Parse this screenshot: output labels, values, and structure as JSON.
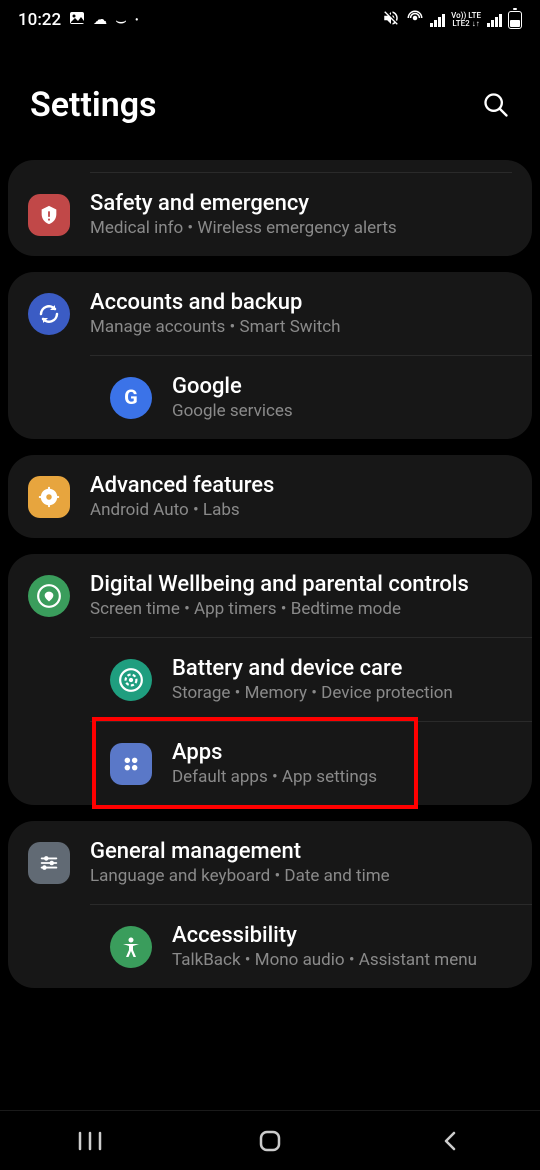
{
  "status": {
    "time": "10:22",
    "lte1": "Vo))",
    "lte2": "LTE",
    "lte3": "LTE2"
  },
  "header": {
    "title": "Settings"
  },
  "groups": [
    {
      "items": [
        {
          "id": "safety",
          "title": "Safety and emergency",
          "subtitle": "Medical info  •  Wireless emergency alerts",
          "icon_bg": "#c14848",
          "icon_shape": "rounded",
          "icon": "emergency"
        }
      ]
    },
    {
      "items": [
        {
          "id": "accounts",
          "title": "Accounts and backup",
          "subtitle": "Manage accounts  •  Smart Switch",
          "icon_bg": "#3b5cc4",
          "icon_shape": "round",
          "icon": "sync"
        },
        {
          "id": "google",
          "title": "Google",
          "subtitle": "Google services",
          "icon_bg": "#3b73e8",
          "icon_shape": "round",
          "icon": "google"
        }
      ]
    },
    {
      "items": [
        {
          "id": "advanced",
          "title": "Advanced features",
          "subtitle": "Android Auto  •  Labs",
          "icon_bg": "#e7a53e",
          "icon_shape": "rounded",
          "icon": "advanced"
        }
      ]
    },
    {
      "items": [
        {
          "id": "wellbeing",
          "title": "Digital Wellbeing and parental controls",
          "subtitle": "Screen time  •  App timers  •  Bedtime mode",
          "icon_bg": "#3a9d5c",
          "icon_shape": "round",
          "icon": "wellbeing"
        },
        {
          "id": "battery",
          "title": "Battery and device care",
          "subtitle": "Storage  •  Memory  •  Device protection",
          "icon_bg": "#1f9e7f",
          "icon_shape": "round",
          "icon": "care"
        },
        {
          "id": "apps",
          "title": "Apps",
          "subtitle": "Default apps  •  App settings",
          "icon_bg": "#5a78c8",
          "icon_shape": "rounded",
          "icon": "apps"
        }
      ]
    },
    {
      "items": [
        {
          "id": "general",
          "title": "General management",
          "subtitle": "Language and keyboard  •  Date and time",
          "icon_bg": "#616a74",
          "icon_shape": "rounded",
          "icon": "sliders"
        },
        {
          "id": "accessibility",
          "title": "Accessibility",
          "subtitle": "TalkBack  •  Mono audio  •  Assistant menu",
          "icon_bg": "#3a9d5c",
          "icon_shape": "round",
          "icon": "accessibility"
        }
      ]
    }
  ],
  "highlight_item": "apps"
}
